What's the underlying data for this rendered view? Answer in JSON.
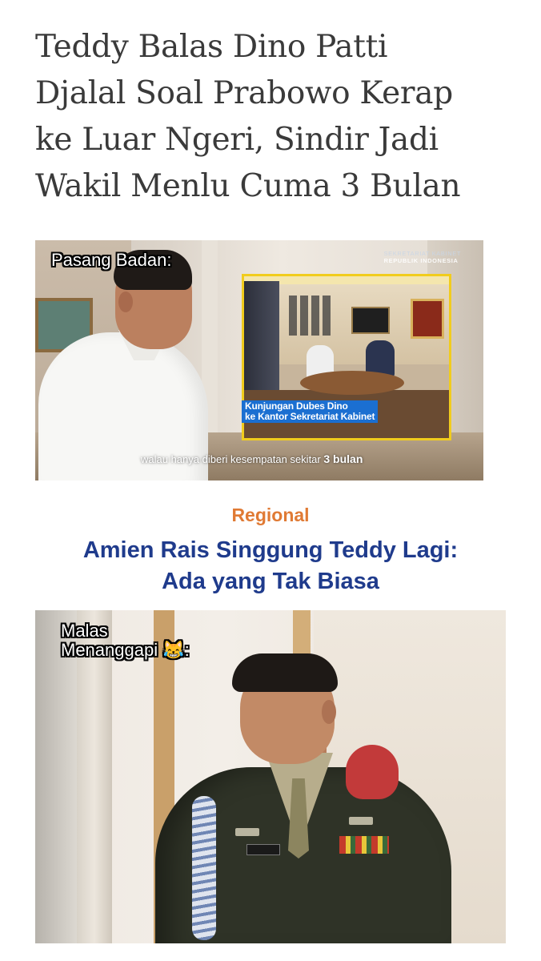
{
  "article": {
    "headline_lines": [
      "Teddy Balas Dino Patti",
      "Djalal Soal Prabowo Kerap",
      "ke Luar Ngeri, Sindir Jadi",
      "Wakil Menlu Cuma 3 Bulan"
    ]
  },
  "image1": {
    "meme_label": "Pasang Badan:",
    "watermark_line1": "SEKRETARIAT KABINET",
    "watermark_line2": "REPUBLIK INDONESIA",
    "inset_caption_line1": "Kunjungan Dubes Dino",
    "inset_caption_line2": "ke Kantor Sekretariat Kabinet",
    "subtitle_text": "walau hanya diberi kesempatan sekitar",
    "subtitle_bold": "3 bulan",
    "frame_color": "#f1cc1d"
  },
  "related": {
    "category": "Regional",
    "category_color": "#e07a34",
    "title_lines": [
      "Amien Rais Singgung Teddy Lagi:",
      "Ada yang Tak Biasa"
    ],
    "title_color": "#1f3b8c"
  },
  "image2": {
    "meme_label_line1": "Malas",
    "meme_label_line2": "Menanggapi 😹:",
    "name_tag": "TEDDY"
  }
}
